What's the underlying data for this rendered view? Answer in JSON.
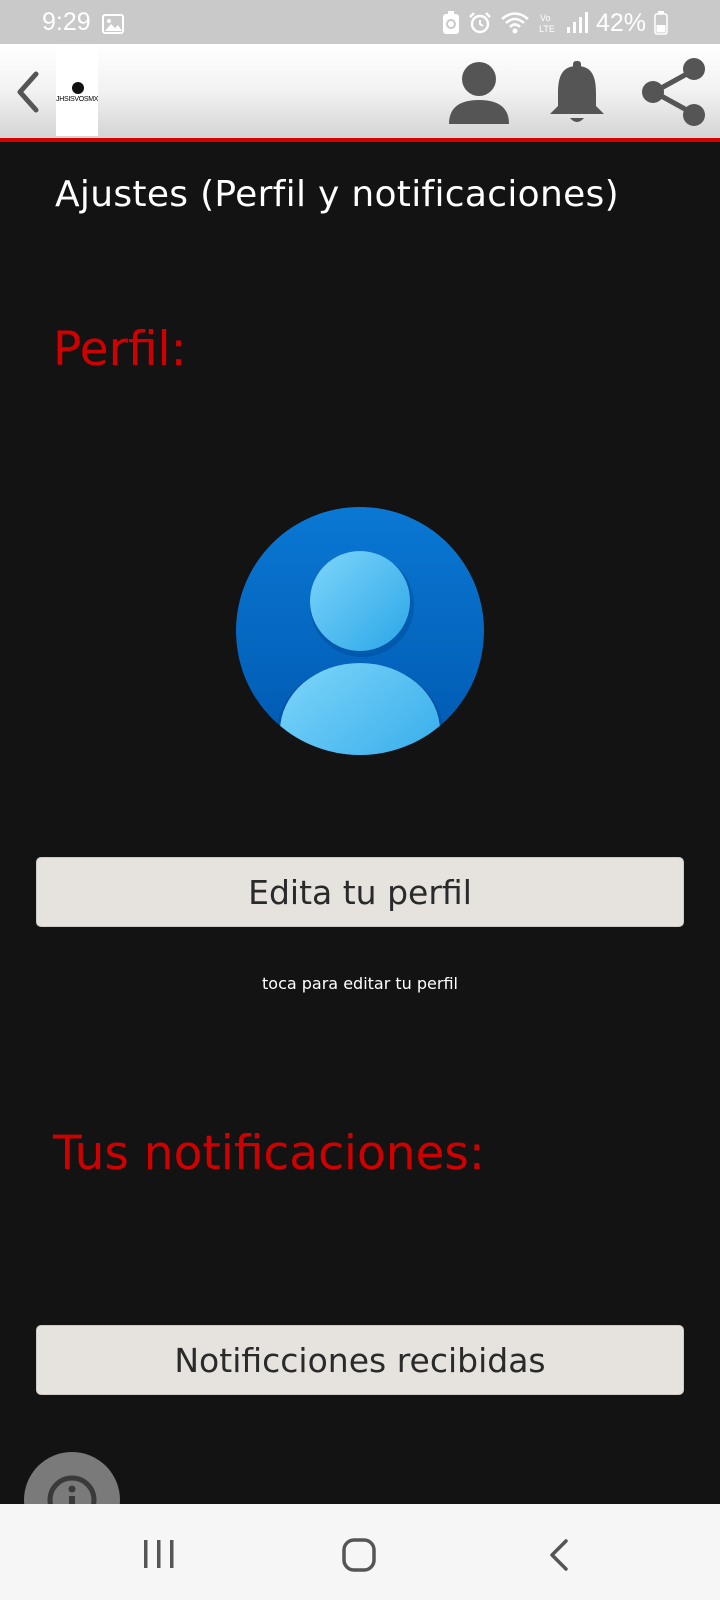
{
  "status_bar": {
    "time": "9:29",
    "battery": "42%",
    "icons": [
      "image-icon",
      "battery-saver-icon",
      "alarm-icon",
      "wifi-icon",
      "volte-icon",
      "signal-icon",
      "battery-icon"
    ]
  },
  "header": {
    "logo_text": "JHSISVOSMX",
    "icons": [
      "back-chevron-icon",
      "user-icon",
      "bell-icon",
      "share-icon"
    ],
    "accent_color": "#d90000"
  },
  "main": {
    "title": "Ajustes (Perfil y notificaciones)",
    "profile_section": {
      "heading": "Perfil:",
      "edit_button": "Edita tu perfil",
      "hint": "toca para editar tu perfil"
    },
    "notifications_section": {
      "heading": "Tus notificaciones:",
      "received_button": "Notificciones recibidas"
    },
    "heading_color": "#d00000"
  },
  "fab": {
    "icon": "info-icon"
  },
  "nav_bar": {
    "icons": [
      "recents-icon",
      "home-icon",
      "back-icon"
    ]
  }
}
